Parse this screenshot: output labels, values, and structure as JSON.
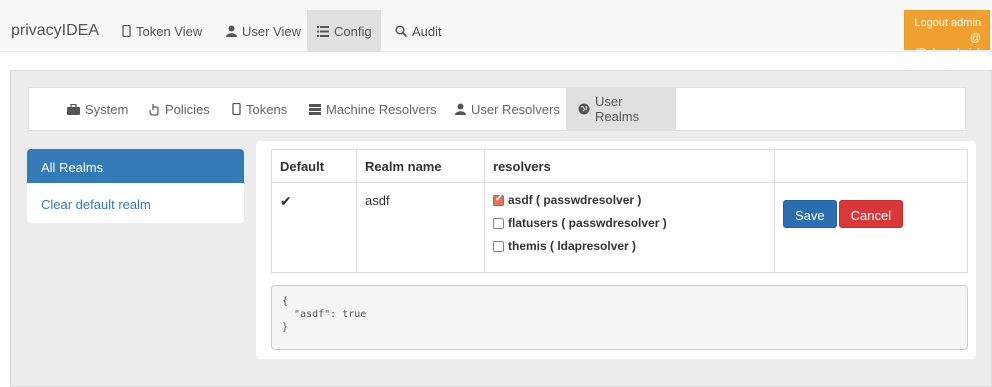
{
  "navbar": {
    "brand": "privacyIDEA",
    "items": [
      {
        "label": "Token View",
        "icon": "phone-icon"
      },
      {
        "label": "User View",
        "icon": "user-icon"
      },
      {
        "label": "Config",
        "icon": "list-icon",
        "active": true
      },
      {
        "label": "Audit",
        "icon": "search-icon"
      }
    ],
    "logout_line1": "Logout admin @",
    "logout_line2": "(Role: admin)"
  },
  "subnav": {
    "items": [
      {
        "label": "System",
        "icon": "briefcase-icon"
      },
      {
        "label": "Policies",
        "icon": "hand-icon"
      },
      {
        "label": "Tokens",
        "icon": "phone-icon"
      },
      {
        "label": "Machine Resolvers",
        "icon": "server-icon"
      },
      {
        "label": "User Resolvers",
        "icon": "user-icon"
      },
      {
        "label": "User Realms",
        "icon": "globe-icon",
        "active": true
      }
    ]
  },
  "sidebar": {
    "active_label": "All Realms",
    "link_label": "Clear default realm"
  },
  "table": {
    "headers": [
      "Default",
      "Realm name",
      "resolvers",
      ""
    ],
    "row": {
      "default_mark": "✔",
      "realm_name": "asdf",
      "resolvers": [
        {
          "label": "asdf ( passwdresolver )",
          "checked": true
        },
        {
          "label": "flatusers ( passwdresolver )",
          "checked": false
        },
        {
          "label": "themis ( ldapresolver )",
          "checked": false
        }
      ],
      "save_label": "Save",
      "cancel_label": "Cancel"
    }
  },
  "json_preview": {
    "line1": "{",
    "line2": "  \"asdf\": true",
    "line3": "}"
  },
  "colors": {
    "primary": "#337ab7",
    "danger": "#d9383a",
    "warning": "#f0a030"
  }
}
